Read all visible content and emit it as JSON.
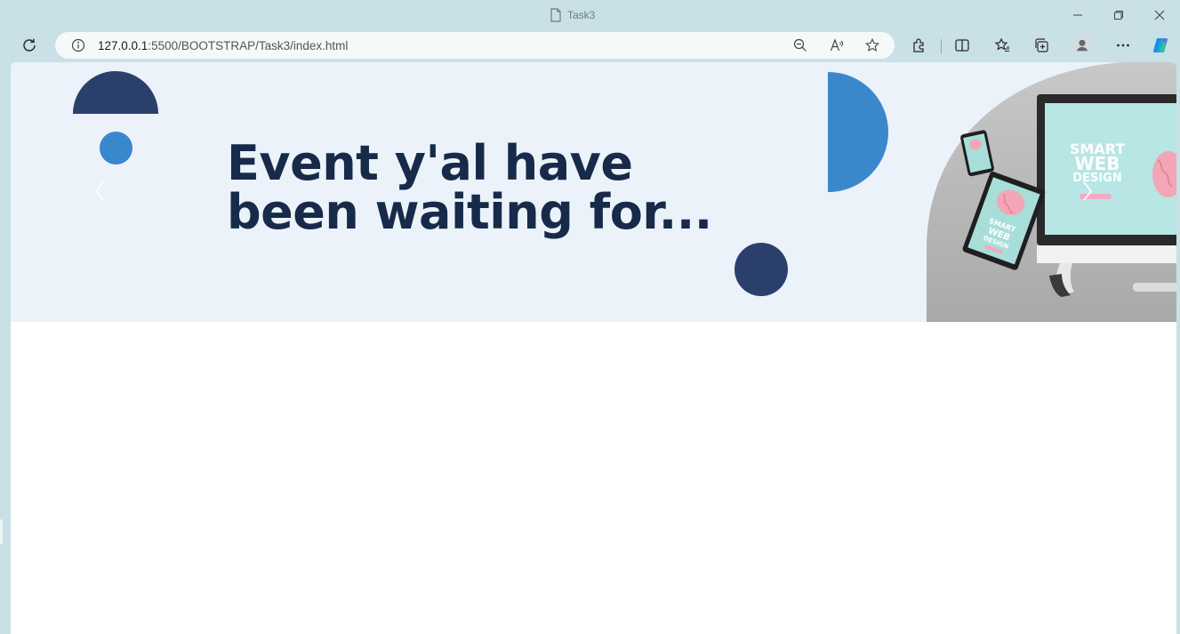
{
  "window": {
    "tab_title": "Task3",
    "controls": [
      "minimize-icon",
      "restore-icon",
      "close-icon"
    ]
  },
  "toolbar": {
    "url_host": "127.0.0.1",
    "url_path": ":5500/BOOTSTRAP/Task3/index.html",
    "icons": [
      "refresh-icon",
      "info-icon",
      "zoom-out-icon",
      "read-aloud-icon",
      "favorite-star-icon",
      "extensions-icon",
      "split-screen-icon",
      "favorites-icon",
      "collections-icon",
      "profile-icon",
      "more-icon",
      "copilot-icon"
    ]
  },
  "hero": {
    "headline_line1": "Event y'al have",
    "headline_line2": "been waiting for...",
    "screen_line1": "SMART",
    "screen_line2": "WEB",
    "screen_line3": "DESIGN",
    "tablet_line1": "SMART",
    "tablet_line2": "WEB",
    "tablet_line3": "DESIGN",
    "prev_icon": "chevron-left-icon",
    "next_icon": "chevron-right-icon"
  },
  "colors": {
    "chrome": "#c9e0e6",
    "hero_bg": "#ebf2f9",
    "navy": "#2b3f6c",
    "blue": "#3b87cb",
    "headline": "#172a4a"
  }
}
